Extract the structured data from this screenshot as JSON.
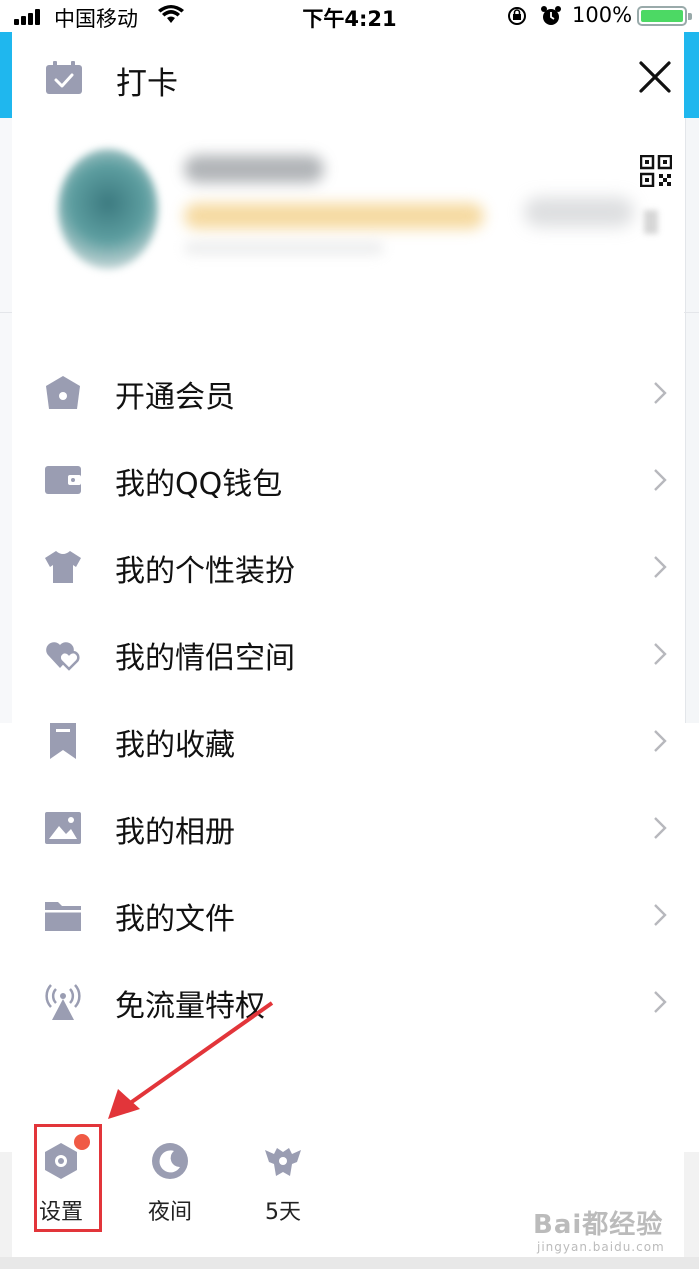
{
  "status_bar": {
    "carrier": "中国移动",
    "time": "下午4:21",
    "battery_percent": "100%",
    "battery_level": 1.0,
    "icons": [
      "signal-icon",
      "wifi-icon",
      "rotation-lock-icon",
      "alarm-icon",
      "battery-icon"
    ]
  },
  "header": {
    "checkin_label": "打卡",
    "checkin_icon": "calendar-check-icon",
    "close_icon": "close-icon"
  },
  "profile": {
    "qr_icon": "qr-code-icon"
  },
  "menu": {
    "items": [
      {
        "label": "开通会员",
        "icon": "crown-icon"
      },
      {
        "label": "我的QQ钱包",
        "icon": "wallet-icon"
      },
      {
        "label": "我的个性装扮",
        "icon": "tshirt-icon"
      },
      {
        "label": "我的情侣空间",
        "icon": "hearts-icon"
      },
      {
        "label": "我的收藏",
        "icon": "bookmark-icon"
      },
      {
        "label": "我的相册",
        "icon": "photo-icon"
      },
      {
        "label": "我的文件",
        "icon": "folder-icon"
      },
      {
        "label": "免流量特权",
        "icon": "broadcast-icon"
      }
    ]
  },
  "bottom_bar": {
    "settings_label": "设置",
    "night_label": "夜间",
    "days_label": "5天"
  },
  "colors": {
    "accent_bg": "#1fb7ee",
    "icon_gray": "#9a9db2",
    "annotation_red": "#e2353a",
    "notification_dot": "#f05a45"
  },
  "watermark": {
    "text": "Bai都经验",
    "sub": "jingyan.baidu.com"
  }
}
